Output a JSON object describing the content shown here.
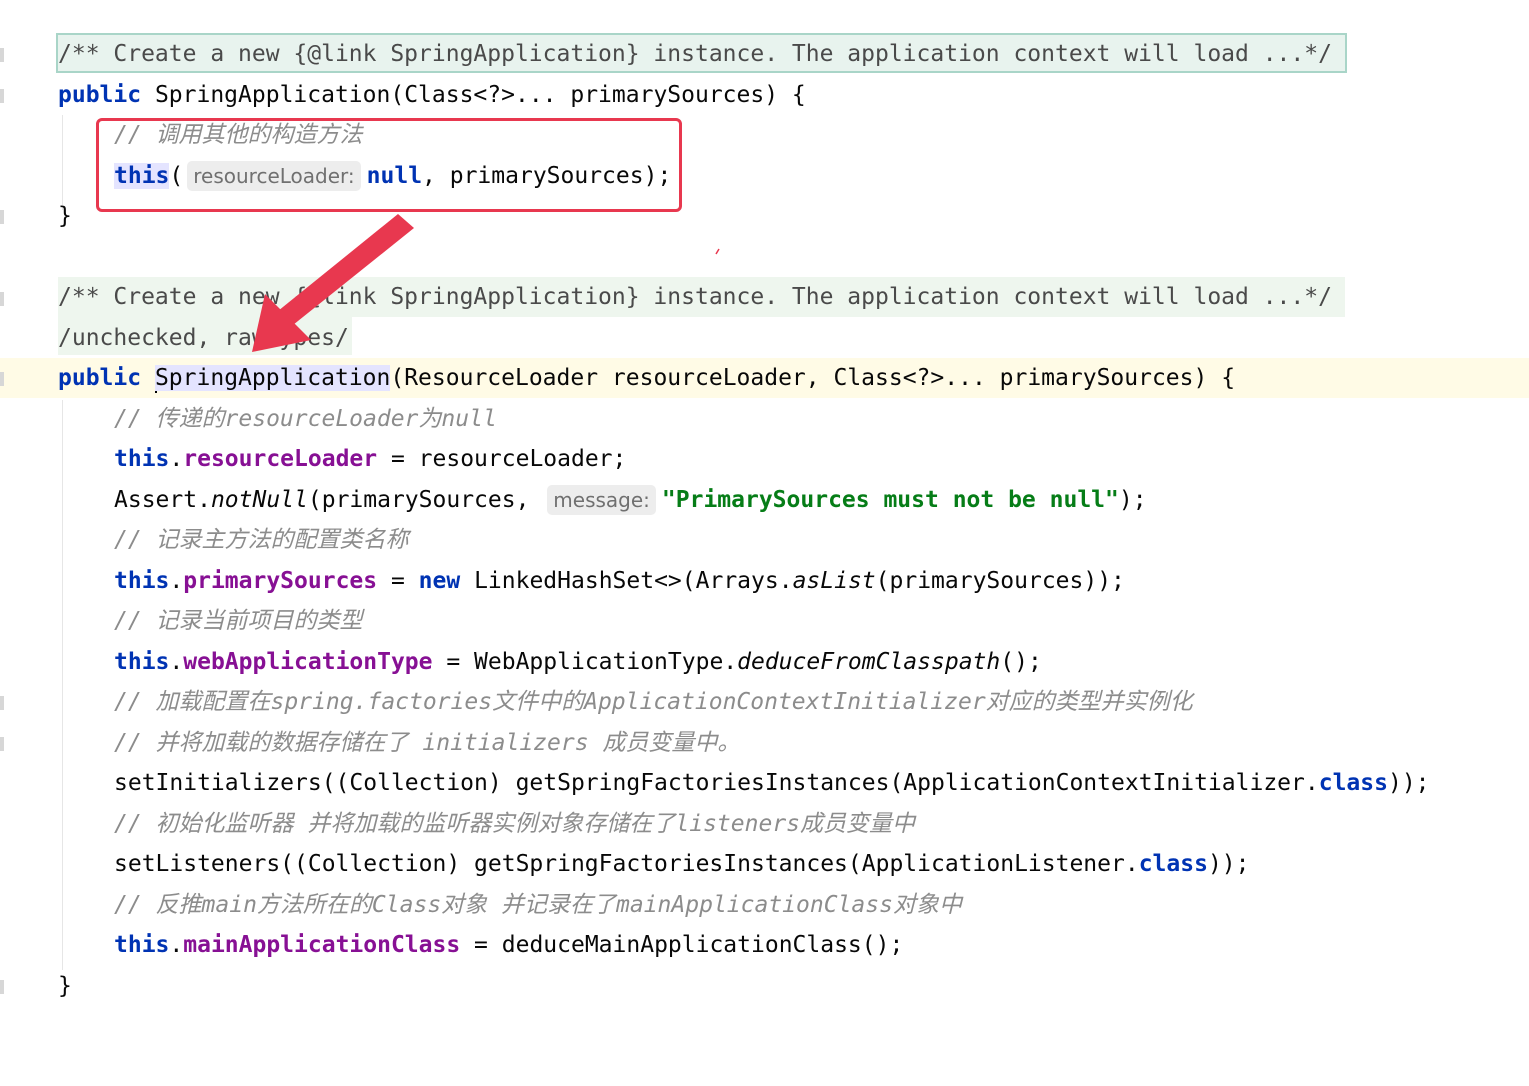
{
  "code": {
    "doc1": "/** Create a new {@link SpringApplication} instance. The application context will load ...*/",
    "ctor1_public": "public",
    "ctor1_sig": " SpringApplication(Class<?>... primarySources) {",
    "ctor1_comment": "// 调用其他的构造方法",
    "ctor1_this": "this",
    "ctor1_paren": "(",
    "ctor1_hint": "resourceLoader:",
    "ctor1_null": "null",
    "ctor1_rest": ", primarySources);",
    "close_brace": "}",
    "doc2": "/** Create a new {@link SpringApplication} instance. The application context will load ...*/",
    "suppress": "/unchecked, rawtypes/",
    "ctor2_public": "public",
    "ctor2_name": "SpringApplication",
    "ctor2_params": "(ResourceLoader resourceLoader, Class<?>... primarySources) {",
    "c1": "// 传递的resourceLoader为null",
    "l1_this": "this",
    "l1_field": "resourceLoader",
    "l1_rest": " = resourceLoader;",
    "l2_a": "Assert.",
    "l2_method": "notNull",
    "l2_b": "(primarySources, ",
    "l2_hint": "message:",
    "l2_str": "\"PrimarySources must not be null\"",
    "l2_c": ");",
    "c2": "// 记录主方法的配置类名称",
    "l3_this": "this",
    "l3_field": "primarySources",
    "l3_eq": " = ",
    "l3_new": "new",
    "l3_a": " LinkedHashSet<>(Arrays.",
    "l3_method": "asList",
    "l3_b": "(primarySources));",
    "c3": "// 记录当前项目的类型",
    "l4_this": "this",
    "l4_field": "webApplicationType",
    "l4_a": " = WebApplicationType.",
    "l4_method": "deduceFromClasspath",
    "l4_b": "();",
    "c4": "// 加载配置在spring.factories文件中的ApplicationContextInitializer对应的类型并实例化",
    "c5": "// 并将加载的数据存储在了 initializers 成员变量中。",
    "l5_a": "setInitializers((Collection) getSpringFactoriesInstances(ApplicationContextInitializer.",
    "l5_kw": "class",
    "l5_b": "));",
    "c6": "// 初始化监听器 并将加载的监听器实例对象存储在了listeners成员变量中",
    "l6_a": "setListeners((Collection) getSpringFactoriesInstances(ApplicationListener.",
    "l6_kw": "class",
    "l6_b": "));",
    "c7": "// 反推main方法所在的Class对象 并记录在了mainApplicationClass对象中",
    "l7_this": "this",
    "l7_field": "mainApplicationClass",
    "l7_rest": " = deduceMainApplicationClass();",
    "close_brace2": "}"
  },
  "annotation": {
    "box_color": "#e8384f",
    "arrow_color": "#e8384f"
  }
}
